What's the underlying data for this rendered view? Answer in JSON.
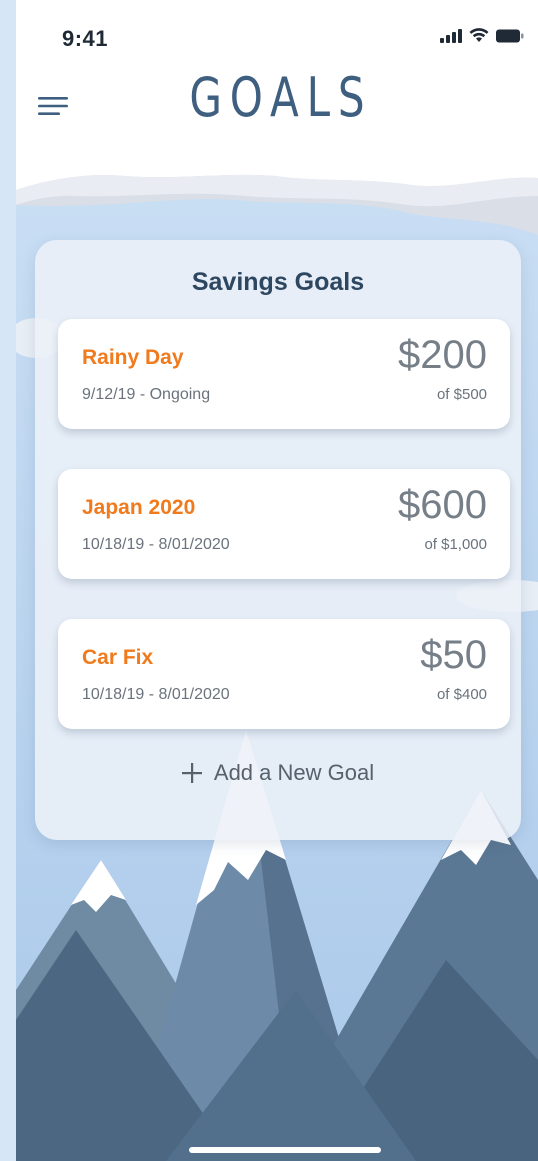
{
  "status_bar": {
    "time": "9:41",
    "icons": [
      "signal-icon",
      "wifi-icon",
      "battery-icon"
    ]
  },
  "header": {
    "title": "GOALS",
    "menu_icon": "hamburger-menu-icon"
  },
  "panel": {
    "title": "Savings Goals",
    "goals": [
      {
        "name": "Rainy Day",
        "dates": "9/12/19 - Ongoing",
        "amount": "$200",
        "target": "of $500"
      },
      {
        "name": "Japan 2020",
        "dates": "10/18/19 - 8/01/2020",
        "amount": "$600",
        "target": "of $1,000"
      },
      {
        "name": "Car Fix",
        "dates": "10/18/19 - 8/01/2020",
        "amount": "$50",
        "target": "of $400"
      }
    ],
    "add_goal_label": "Add a New Goal",
    "add_goal_icon": "plus-icon"
  },
  "colors": {
    "accent_orange": "#f07a1c",
    "title_blue": "#3f5f80",
    "sky": "#b9d4ef",
    "mountain_dark": "#4d6c87"
  }
}
